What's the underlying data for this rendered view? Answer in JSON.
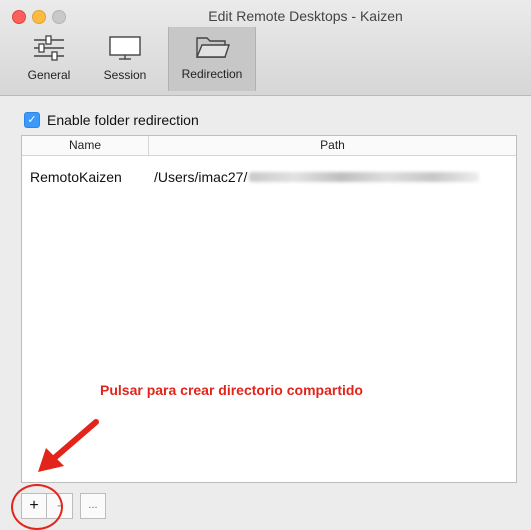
{
  "window": {
    "title": "Edit Remote Desktops - Kaizen"
  },
  "toolbar": {
    "tabs": [
      {
        "label": "General",
        "icon": "sliders-icon"
      },
      {
        "label": "Session",
        "icon": "monitor-icon"
      },
      {
        "label": "Redirection",
        "icon": "folder-icon",
        "selected": true
      }
    ]
  },
  "redirection": {
    "enable_label": "Enable folder redirection",
    "enabled": true,
    "columns": [
      "Name",
      "Path"
    ],
    "rows": [
      {
        "name": "RemotoKaizen",
        "path": "/Users/imac27/"
      }
    ]
  },
  "annotation": {
    "text": "Pulsar para crear directorio compartido",
    "color": "#e3241b"
  },
  "buttons": {
    "add": "+",
    "remove": "-",
    "more": "..."
  }
}
